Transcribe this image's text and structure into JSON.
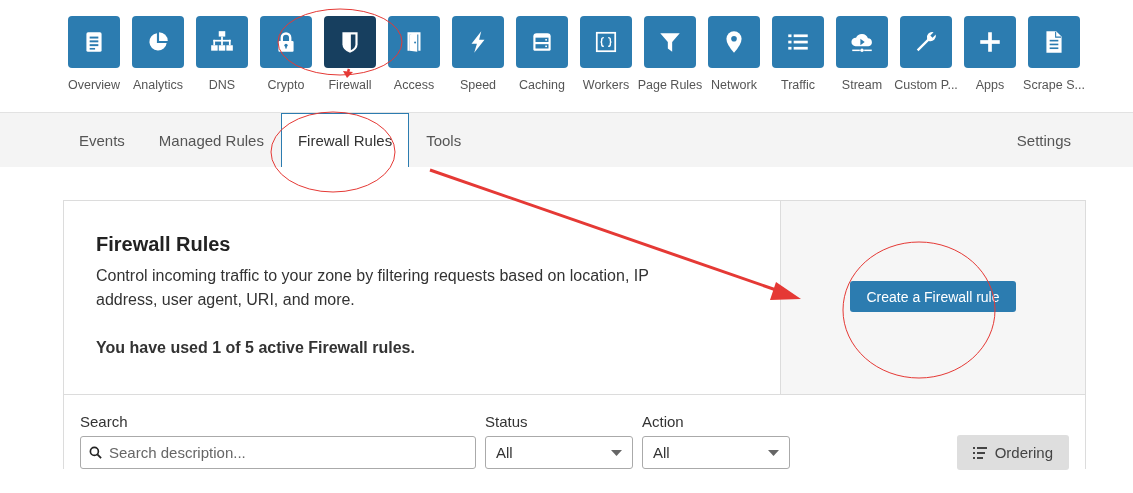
{
  "nav": [
    {
      "label": "Overview",
      "selected": false
    },
    {
      "label": "Analytics",
      "selected": false
    },
    {
      "label": "DNS",
      "selected": false
    },
    {
      "label": "Crypto",
      "selected": false
    },
    {
      "label": "Firewall",
      "selected": true
    },
    {
      "label": "Access",
      "selected": false
    },
    {
      "label": "Speed",
      "selected": false
    },
    {
      "label": "Caching",
      "selected": false
    },
    {
      "label": "Workers",
      "selected": false
    },
    {
      "label": "Page Rules",
      "selected": false
    },
    {
      "label": "Network",
      "selected": false
    },
    {
      "label": "Traffic",
      "selected": false
    },
    {
      "label": "Stream",
      "selected": false
    },
    {
      "label": "Custom P...",
      "selected": false
    },
    {
      "label": "Apps",
      "selected": false
    },
    {
      "label": "Scrape S...",
      "selected": false
    }
  ],
  "tabs": [
    {
      "label": "Events",
      "selected": false
    },
    {
      "label": "Managed Rules",
      "selected": false
    },
    {
      "label": "Firewall Rules",
      "selected": true
    },
    {
      "label": "Tools",
      "selected": false
    }
  ],
  "settings_link": "Settings",
  "card": {
    "title": "Firewall Rules",
    "description": "Control incoming traffic to your zone by filtering requests based on location, IP address, user agent, URI, and more.",
    "usage": "You have used 1 of 5 active Firewall rules.",
    "create_button": "Create a Firewall rule"
  },
  "filters": {
    "search": {
      "label": "Search",
      "placeholder": "Search description..."
    },
    "status": {
      "label": "Status",
      "value": "All"
    },
    "action": {
      "label": "Action",
      "value": "All"
    },
    "ordering_button": "Ordering"
  }
}
